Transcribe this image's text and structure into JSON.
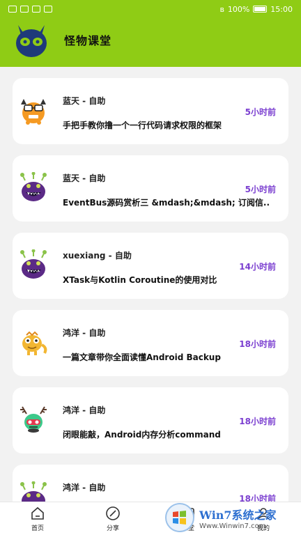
{
  "status_bar": {
    "battery": "100%",
    "time": "15:00"
  },
  "app": {
    "title": "怪物课堂"
  },
  "feed": [
    {
      "author": "蓝天 - 自助",
      "time": "5小时前",
      "title": "手把手教你撸一个一行代码请求权限的框架",
      "avatar": "orange-glasses-monster"
    },
    {
      "author": "蓝天 - 自助",
      "time": "5小时前",
      "title": "EventBus源码赏析三 &mdash;&mdash; 订阅信..",
      "avatar": "purple-monster"
    },
    {
      "author": "xuexiang - 自助",
      "time": "14小时前",
      "title": "XTask与Kotlin Coroutine的使用对比",
      "avatar": "purple-monster"
    },
    {
      "author": "鸿洋 - 自助",
      "time": "18小时前",
      "title": "一篇文章带你全面读懂Android Backup",
      "avatar": "yellow-lizard-monster"
    },
    {
      "author": "鸿洋 - 自助",
      "time": "18小时前",
      "title": "闭眼能敲，Android内存分析command",
      "avatar": "antler-monster"
    },
    {
      "author": "鸿洋 - 自助",
      "time": "18小时前",
      "title": "",
      "avatar": "purple-monster"
    }
  ],
  "tabs": [
    {
      "label": "首页",
      "icon": "home-icon"
    },
    {
      "label": "分享",
      "icon": "compass-icon"
    },
    {
      "label": "课堂",
      "icon": "class-icon"
    },
    {
      "label": "我的",
      "icon": "profile-icon"
    }
  ],
  "watermark": {
    "brand": "Win7系统之家",
    "url": "Www.Winwin7.com"
  },
  "colors": {
    "header": "#8fcc15",
    "time": "#7b3fd0",
    "background": "#f2f2f2"
  }
}
